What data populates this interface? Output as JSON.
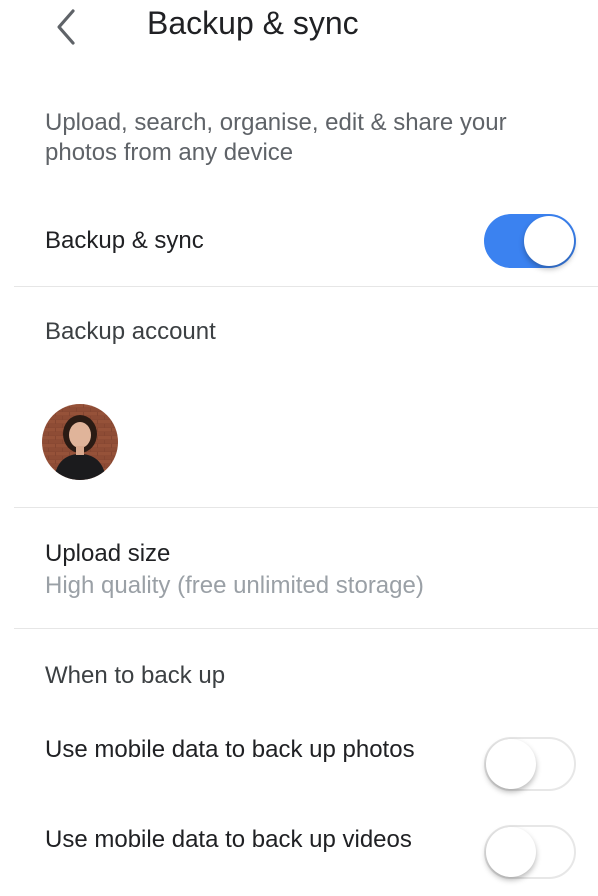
{
  "header": {
    "back_icon": "chevron-left-icon",
    "title": "Backup & sync"
  },
  "intro": "Upload, search, organise, edit & share your photos from any device",
  "backup_sync": {
    "label": "Backup & sync",
    "enabled": true,
    "accent_color": "#3b82f0"
  },
  "backup_account": {
    "label": "Backup account"
  },
  "upload_size": {
    "label": "Upload size",
    "value": "High quality (free unlimited storage)"
  },
  "when_to_back_up": {
    "label": "When to back up"
  },
  "mobile_data_photos": {
    "label": "Use mobile data to back up photos",
    "enabled": false
  },
  "mobile_data_videos": {
    "label": "Use mobile data to back up videos",
    "enabled": false
  }
}
